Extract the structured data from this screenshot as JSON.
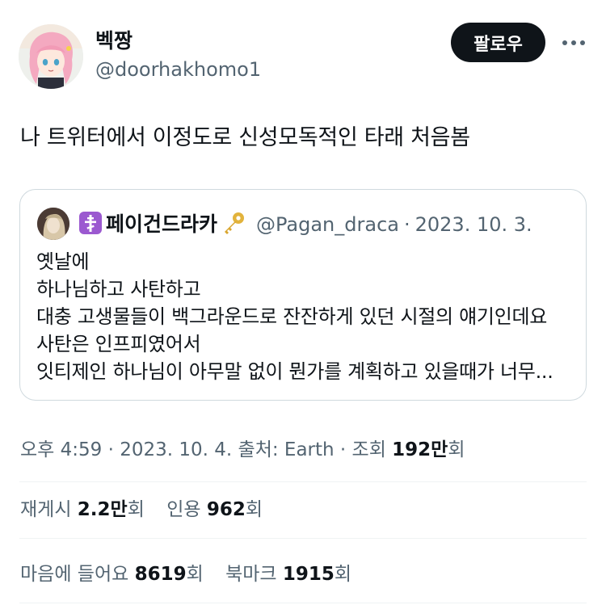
{
  "author": {
    "display_name": "벡짱",
    "handle": "@doorhakhomo1"
  },
  "follow_label": "팔로우",
  "tweet_text": "나 트위터에서 이정도로 신성모독적인 타래 처음봄",
  "quote": {
    "display_name": "페이건드라카",
    "handle": "@Pagan_draca",
    "separator": "·",
    "date": "2023. 10. 3.",
    "lines": [
      "옛날에",
      "하나님하고 사탄하고",
      "대충 고생물들이 백그라운드로 잔잔하게 있던 시절의 얘기인데요",
      "사탄은 인프피였어서",
      "잇티제인 하나님이 아무말 없이 뭔가를 계획하고 있을때가 너무..."
    ]
  },
  "meta": {
    "time": "오후 4:59",
    "sep": "·",
    "date": "2023. 10. 4.",
    "source_label": "출처: Earth",
    "views_label": "조회",
    "views_value": "192만",
    "views_unit": "회"
  },
  "stats": {
    "retweets_label": "재게시",
    "retweets_value": "2.2만",
    "retweets_unit": "회",
    "quotes_label": "인용",
    "quotes_value": "962",
    "quotes_unit": "회",
    "likes_label": "마음에 들어요",
    "likes_value": "8619",
    "likes_unit": "회",
    "bookmarks_label": "북마크",
    "bookmarks_value": "1915",
    "bookmarks_unit": "회"
  },
  "icons": {
    "cross_badge": "orthodox-cross-icon",
    "key_badge": "key-icon",
    "more": "more-horizontal-icon"
  },
  "colors": {
    "accent_dark": "#0f1419",
    "secondary_text": "#536471",
    "border": "#cfd9de",
    "badge_purple": "#9b59d0",
    "key_gold": "#e2b33c"
  }
}
